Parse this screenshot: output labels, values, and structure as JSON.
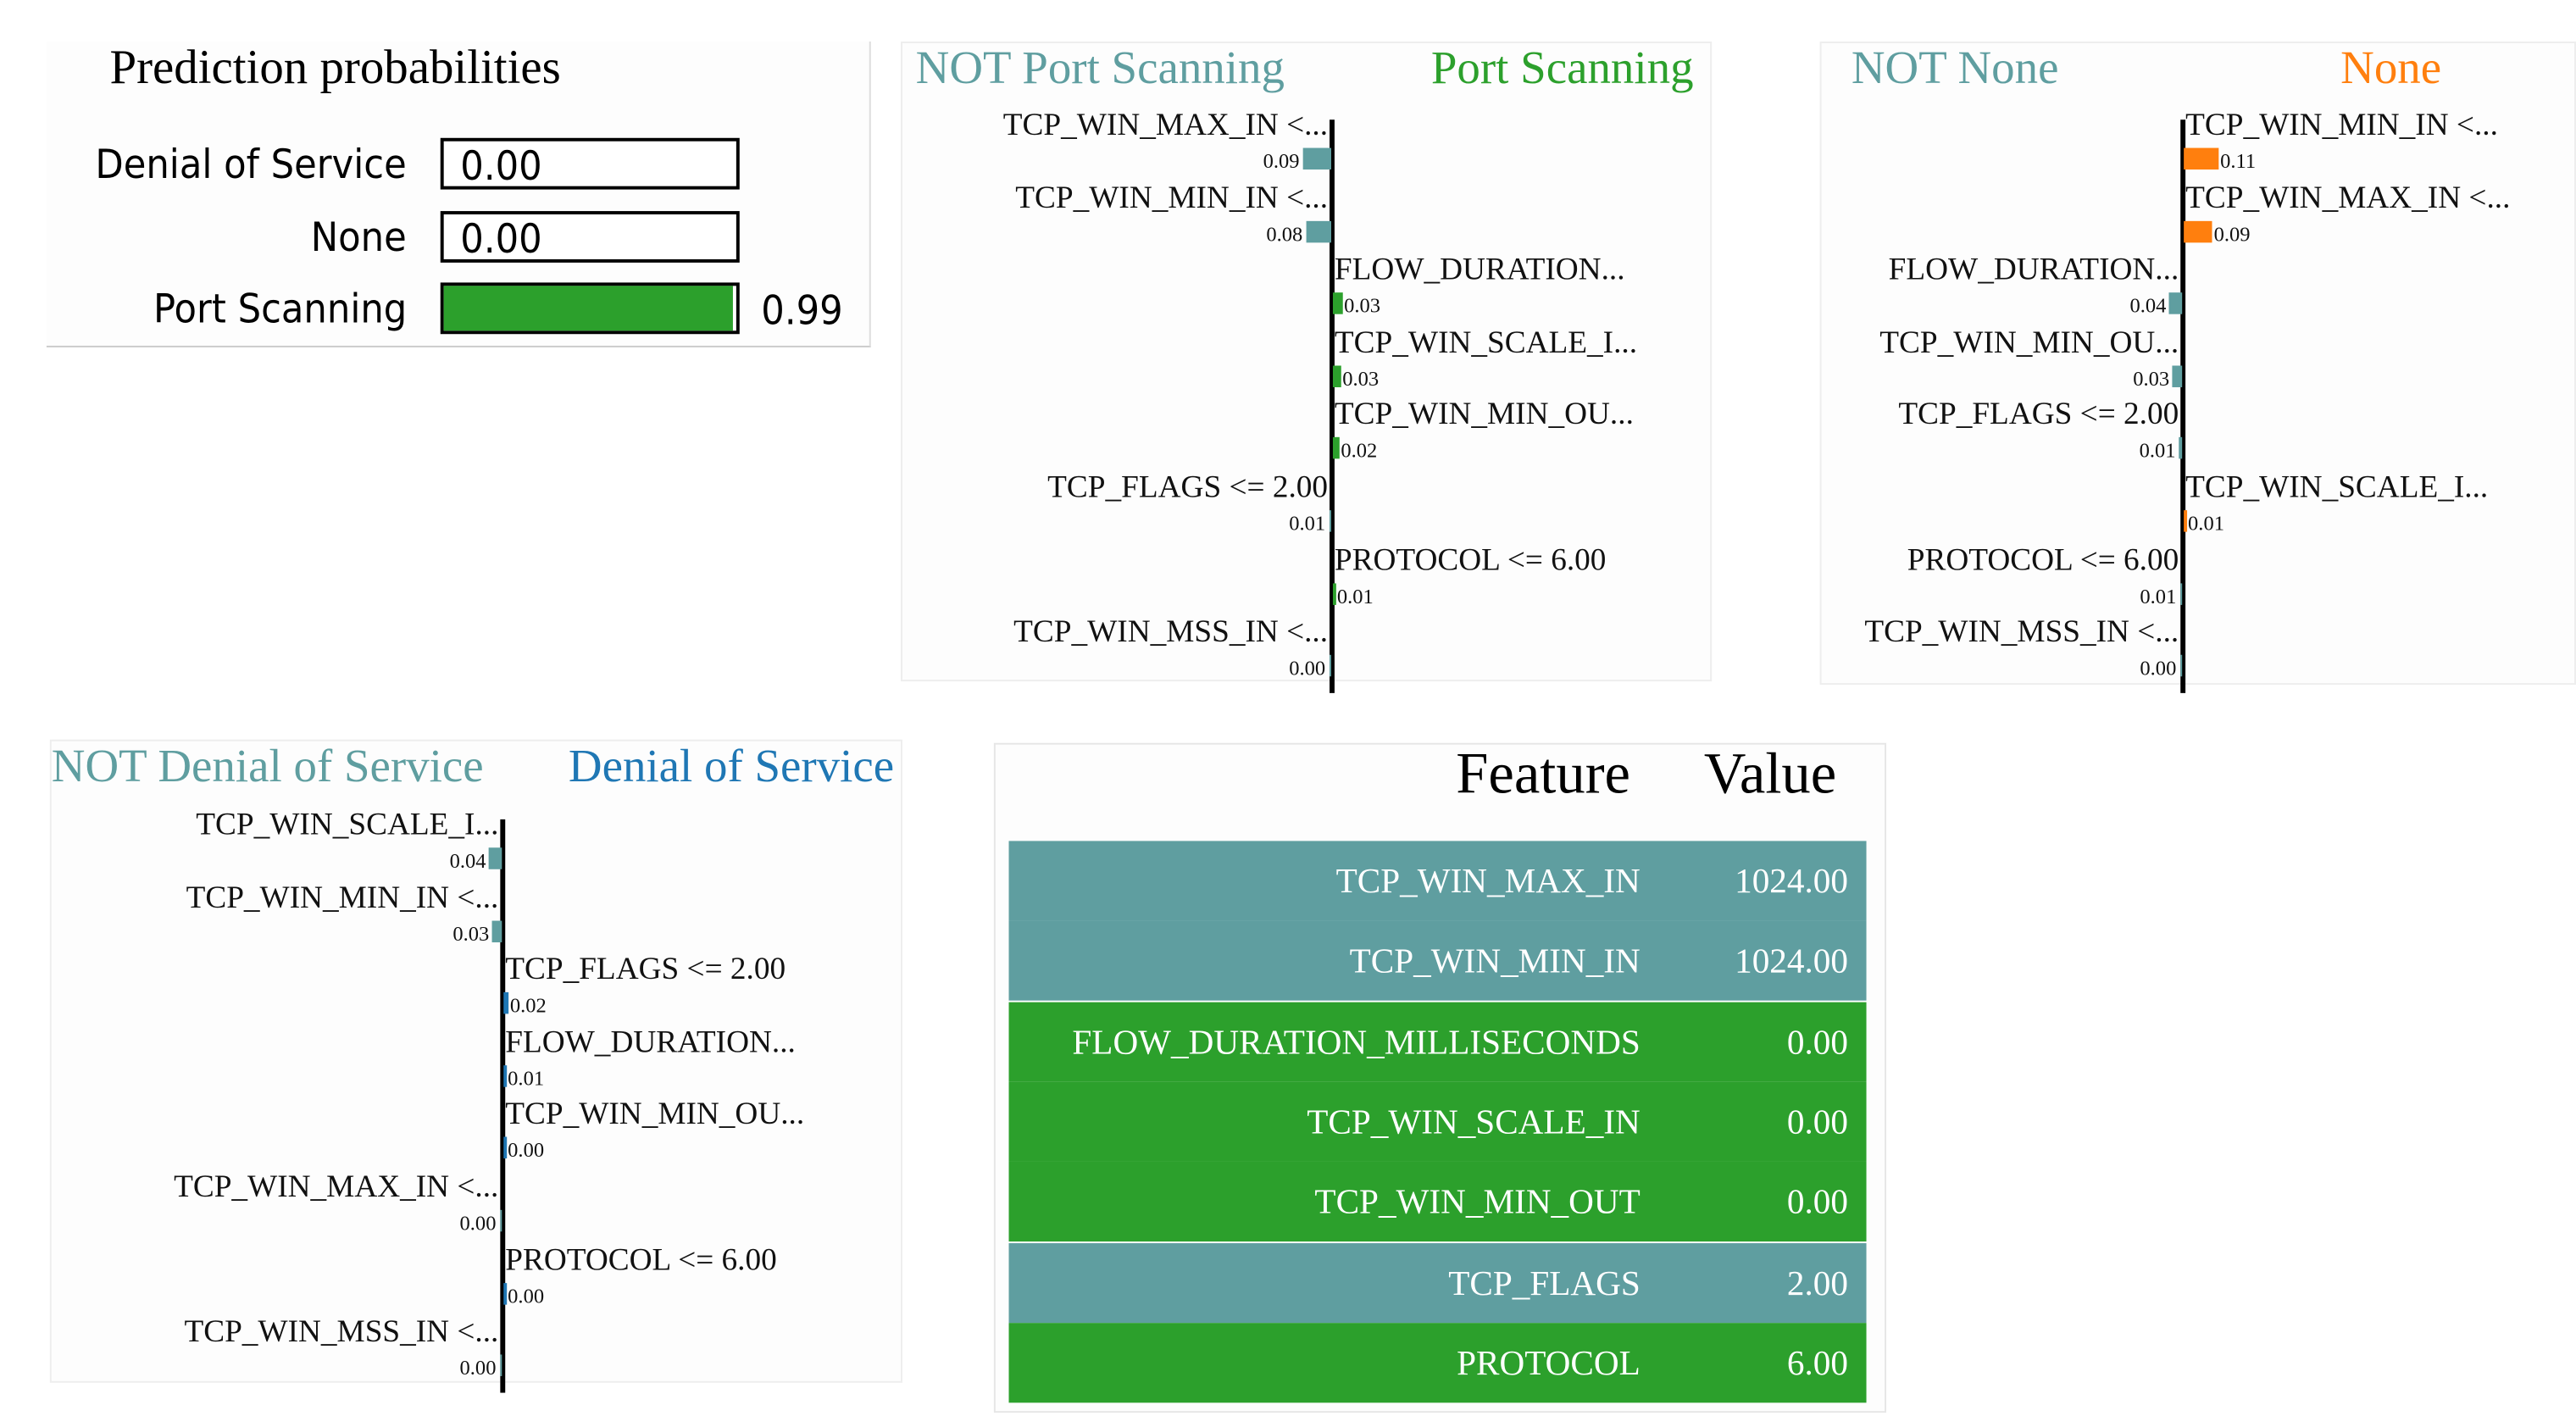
{
  "colors": {
    "positive_green": "#2ca02c",
    "negative_teal": "#5f9ea0",
    "none_orange": "#ff7f0e",
    "dos_blue": "#1f77b4"
  },
  "prediction": {
    "title": "Prediction probabilities",
    "rows": [
      {
        "label": "Denial of Service",
        "value": "0.00",
        "fraction": 0.0,
        "color": "#1f77b4"
      },
      {
        "label": "None",
        "value": "0.00",
        "fraction": 0.0,
        "color": "#ff7f0e"
      },
      {
        "label": "Port Scanning",
        "value": "0.99",
        "fraction": 0.99,
        "color": "#2ca02c"
      }
    ]
  },
  "chart_data": [
    {
      "type": "bar",
      "title": "Port Scanning",
      "neg_label": "NOT Port Scanning",
      "pos_label": "Port Scanning",
      "pos_color": "#2ca02c",
      "neg_color": "#5f9ea0",
      "features": [
        {
          "label": "TCP_WIN_MAX_IN <...",
          "value": -0.09,
          "text": "0.09"
        },
        {
          "label": "TCP_WIN_MIN_IN <...",
          "value": -0.08,
          "text": "0.08"
        },
        {
          "label": "FLOW_DURATION...",
          "value": 0.03,
          "text": "0.03"
        },
        {
          "label": "TCP_WIN_SCALE_I...",
          "value": 0.025,
          "text": "0.03"
        },
        {
          "label": "TCP_WIN_MIN_OU...",
          "value": 0.02,
          "text": "0.02"
        },
        {
          "label": "TCP_FLAGS <= 2.00",
          "value": -0.005,
          "text": "0.01"
        },
        {
          "label": "PROTOCOL <= 6.00",
          "value": 0.005,
          "text": "0.01"
        },
        {
          "label": "TCP_WIN_MSS_IN <...",
          "value": -0.001,
          "text": "0.00"
        }
      ]
    },
    {
      "type": "bar",
      "title": "None",
      "neg_label": "NOT None",
      "pos_label": "None",
      "pos_color": "#ff7f0e",
      "neg_color": "#5f9ea0",
      "features": [
        {
          "label": "TCP_WIN_MIN_IN <...",
          "value": 0.11,
          "text": "0.11"
        },
        {
          "label": "TCP_WIN_MAX_IN <...",
          "value": 0.09,
          "text": "0.09"
        },
        {
          "label": "FLOW_DURATION...",
          "value": -0.04,
          "text": "0.04"
        },
        {
          "label": "TCP_WIN_MIN_OU...",
          "value": -0.03,
          "text": "0.03"
        },
        {
          "label": "TCP_FLAGS <= 2.00",
          "value": -0.01,
          "text": "0.01"
        },
        {
          "label": "TCP_WIN_SCALE_I...",
          "value": 0.006,
          "text": "0.01"
        },
        {
          "label": "PROTOCOL <= 6.00",
          "value": -0.005,
          "text": "0.01"
        },
        {
          "label": "TCP_WIN_MSS_IN <...",
          "value": -0.001,
          "text": "0.00"
        }
      ]
    },
    {
      "type": "bar",
      "title": "Denial of Service",
      "neg_label": "NOT Denial of Service",
      "pos_label": "Denial of Service",
      "pos_color": "#1f77b4",
      "neg_color": "#5f9ea0",
      "features": [
        {
          "label": "TCP_WIN_SCALE_I...",
          "value": -0.04,
          "text": "0.04"
        },
        {
          "label": "TCP_WIN_MIN_IN <...",
          "value": -0.03,
          "text": "0.03"
        },
        {
          "label": "TCP_FLAGS <= 2.00",
          "value": 0.015,
          "text": "0.02"
        },
        {
          "label": "FLOW_DURATION...",
          "value": 0.006,
          "text": "0.01"
        },
        {
          "label": "TCP_WIN_MIN_OU...",
          "value": 0.002,
          "text": "0.00"
        },
        {
          "label": "TCP_WIN_MAX_IN <...",
          "value": -0.002,
          "text": "0.00"
        },
        {
          "label": "PROTOCOL <= 6.00",
          "value": 0.001,
          "text": "0.00"
        },
        {
          "label": "TCP_WIN_MSS_IN <...",
          "value": -0.001,
          "text": "0.00"
        }
      ]
    }
  ],
  "table": {
    "headers": {
      "feature": "Feature",
      "value": "Value"
    },
    "rows": [
      {
        "feature": "TCP_WIN_MAX_IN",
        "value": "1024.00",
        "color": "#5f9ea0"
      },
      {
        "feature": "TCP_WIN_MIN_IN",
        "value": "1024.00",
        "color": "#5f9ea0"
      },
      {
        "feature": "FLOW_DURATION_MILLISECONDS",
        "value": "0.00",
        "color": "#2ca02c"
      },
      {
        "feature": "TCP_WIN_SCALE_IN",
        "value": "0.00",
        "color": "#2ca02c"
      },
      {
        "feature": "TCP_WIN_MIN_OUT",
        "value": "0.00",
        "color": "#2ca02c"
      },
      {
        "feature": "TCP_FLAGS",
        "value": "2.00",
        "color": "#5f9ea0"
      },
      {
        "feature": "PROTOCOL",
        "value": "6.00",
        "color": "#2ca02c"
      }
    ]
  }
}
